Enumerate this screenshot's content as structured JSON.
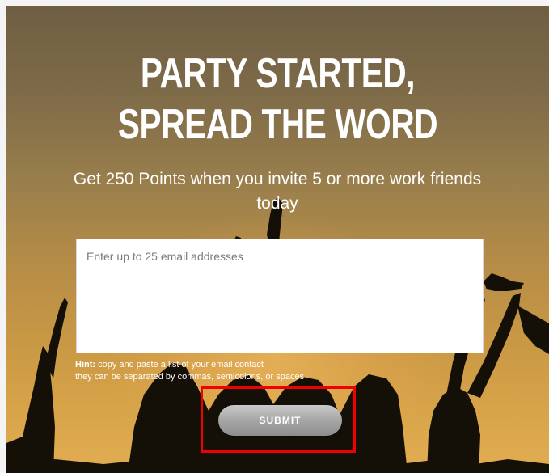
{
  "headline": {
    "line1": "PARTY STARTED,",
    "line2": "SPREAD THE WORD"
  },
  "subheadline": "Get 250 Points when you invite 5 or more work friends today",
  "email_input": {
    "value": "",
    "placeholder": "Enter up to 25 email addresses"
  },
  "hint": {
    "label": "Hint:",
    "line1": " copy and paste a list of your email contact",
    "line2": "they can be separated by commas, semicolons, or spaces"
  },
  "submit_label": "SUBMIT",
  "colors": {
    "highlight_border": "#f20000",
    "button": "#a6a6a6",
    "sunset_top": "#6f5e43",
    "sunset_bottom": "#e2ad52"
  }
}
